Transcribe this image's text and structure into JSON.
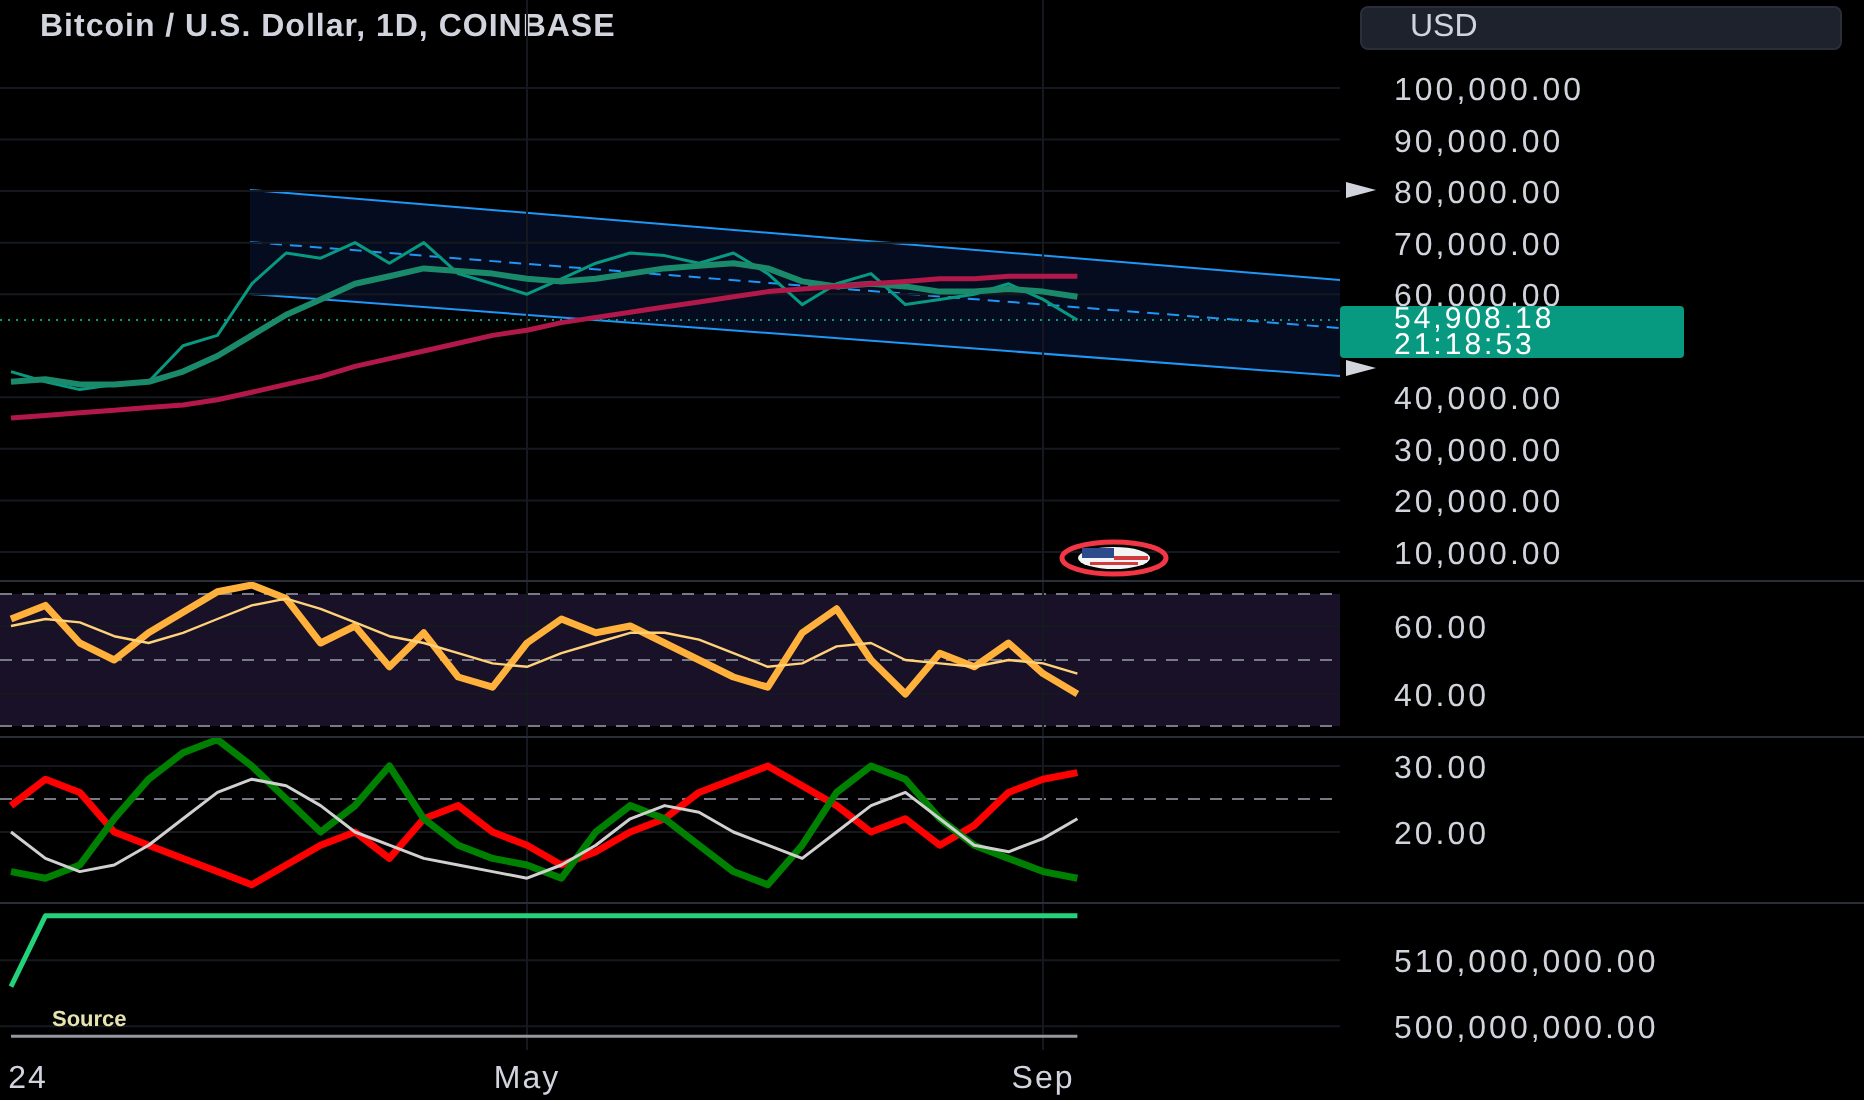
{
  "title": "Bitcoin / U.S. Dollar, 1D, COINBASE",
  "currency_button": "USD",
  "last_price": {
    "price": "54,908.18",
    "countdown": "21:18:53"
  },
  "price_pane": {
    "chart_data": {
      "type": "line",
      "grid": true,
      "ylim": [
        4180,
        117060
      ],
      "yticks": [
        {
          "value": 100000,
          "label": "100,000.00"
        },
        {
          "value": 90000,
          "label": "90,000.00"
        },
        {
          "value": 80000,
          "label": "80,000.00"
        },
        {
          "value": 70000,
          "label": "70,000.00"
        },
        {
          "value": 60000,
          "label": "60,000.00"
        },
        {
          "value": 40000,
          "label": "40,000.00"
        },
        {
          "value": 30000,
          "label": "30,000.00"
        },
        {
          "value": 20000,
          "label": "20,000.00"
        },
        {
          "value": 10000,
          "label": "10,000.00"
        }
      ],
      "series": [
        {
          "color": "#089981",
          "values": [
            45000,
            43000,
            41500,
            42500,
            43000,
            50000,
            52000,
            62000,
            68000,
            67000,
            70000,
            66000,
            70000,
            64000,
            62000,
            60000,
            63000,
            66000,
            68000,
            67500,
            66000,
            68000,
            64000,
            58000,
            62000,
            64000,
            58000,
            59000,
            60000,
            62000,
            59000,
            55000
          ]
        },
        {
          "color": "#1b8a6b",
          "values": [
            43000,
            43500,
            42500,
            42500,
            43000,
            45000,
            48000,
            52000,
            56000,
            59000,
            62000,
            63500,
            65000,
            64500,
            64000,
            63000,
            62500,
            63000,
            64000,
            65000,
            65500,
            66000,
            65000,
            62500,
            61500,
            62000,
            61500,
            60500,
            60500,
            61000,
            60500,
            59500
          ]
        },
        {
          "color": "#b2194a",
          "values": [
            36000,
            36500,
            37000,
            37500,
            38000,
            38500,
            39500,
            41000,
            42500,
            44000,
            46000,
            47500,
            49000,
            50500,
            52000,
            53000,
            54500,
            55500,
            56500,
            57500,
            58500,
            59500,
            60500,
            61000,
            61500,
            62000,
            62500,
            63000,
            63000,
            63500,
            63500,
            63500
          ]
        }
      ]
    }
  },
  "rsi_pane": {
    "chart_data": {
      "type": "line",
      "grid": true,
      "ylim": [
        27.06,
        72.9
      ],
      "yticks": [
        {
          "value": 60,
          "label": "60.00"
        },
        {
          "value": 40,
          "label": "40.00"
        }
      ],
      "series": [
        {
          "color": "#ffb13b",
          "values": [
            62,
            66,
            55,
            50,
            58,
            64,
            70,
            72,
            68,
            55,
            60,
            48,
            58,
            45,
            42,
            55,
            62,
            58,
            60,
            55,
            50,
            45,
            42,
            58,
            65,
            50,
            40,
            52,
            48,
            55,
            46,
            40
          ]
        },
        {
          "color": "#ffd27a",
          "values": [
            60,
            62,
            61,
            57,
            55,
            58,
            62,
            66,
            68,
            65,
            61,
            57,
            55,
            52,
            49,
            48,
            52,
            55,
            58,
            58,
            56,
            52,
            48,
            49,
            54,
            55,
            50,
            49,
            48,
            50,
            49,
            46
          ]
        }
      ]
    }
  },
  "dmi_pane": {
    "chart_data": {
      "type": "line",
      "grid": true,
      "ylim": [
        9.09,
        34.24
      ],
      "yticks": [
        {
          "value": 30,
          "label": "30.00"
        },
        {
          "value": 20,
          "label": "20.00"
        }
      ],
      "series": [
        {
          "color": "#ff0000",
          "values": [
            24,
            28,
            26,
            20,
            18,
            16,
            14,
            12,
            15,
            18,
            20,
            16,
            22,
            24,
            20,
            18,
            15,
            17,
            20,
            22,
            26,
            28,
            30,
            27,
            24,
            20,
            22,
            18,
            21,
            26,
            28,
            29
          ]
        },
        {
          "color": "#008000",
          "values": [
            14,
            13,
            15,
            22,
            28,
            32,
            34,
            30,
            25,
            20,
            24,
            30,
            22,
            18,
            16,
            15,
            13,
            20,
            24,
            22,
            18,
            14,
            12,
            18,
            26,
            30,
            28,
            22,
            18,
            16,
            14,
            13
          ]
        },
        {
          "color": "#d0d0d0",
          "values": [
            20,
            16,
            14,
            15,
            18,
            22,
            26,
            28,
            27,
            24,
            20,
            18,
            16,
            15,
            14,
            13,
            15,
            18,
            22,
            24,
            23,
            20,
            18,
            16,
            20,
            24,
            26,
            22,
            18,
            17,
            19,
            22
          ]
        }
      ]
    }
  },
  "supply_pane": {
    "source_label": "Source",
    "chart_data": {
      "type": "line",
      "grid": true,
      "categories": [
        "24",
        null,
        null,
        null,
        null,
        null,
        null,
        null,
        null,
        null,
        null,
        null,
        null,
        null,
        null,
        "May",
        null,
        null,
        null,
        null,
        null,
        null,
        null,
        null,
        null,
        null,
        null,
        null,
        null,
        null,
        "Sep",
        null
      ],
      "ylim": [
        496400000,
        518500000
      ],
      "yticks": [
        {
          "value": 510000000,
          "label": "510,000,000.00"
        },
        {
          "value": 500000000,
          "label": "500,000,000.00"
        }
      ],
      "series": [
        {
          "color": "#22d37a",
          "values": [
            506000000,
            516700000,
            516700000,
            516700000,
            516700000,
            516700000,
            516700000,
            516700000,
            516700000,
            516700000,
            516700000,
            516700000,
            516700000,
            516700000,
            516700000,
            516700000,
            516700000,
            516700000,
            516700000,
            516700000,
            516700000,
            516700000,
            516700000,
            516700000,
            516700000,
            516700000,
            516700000,
            516700000,
            516700000,
            516700000,
            516700000,
            516700000
          ]
        },
        {
          "color": "#9598a1",
          "values": [
            498500000,
            498500000,
            498500000,
            498500000,
            498500000,
            498500000,
            498500000,
            498500000,
            498500000,
            498500000,
            498500000,
            498500000,
            498500000,
            498500000,
            498500000,
            498500000,
            498500000,
            498500000,
            498500000,
            498500000,
            498500000,
            498500000,
            498500000,
            498500000,
            498500000,
            498500000,
            498500000,
            498500000,
            498500000,
            498500000,
            498500000,
            498500000
          ]
        }
      ]
    }
  }
}
